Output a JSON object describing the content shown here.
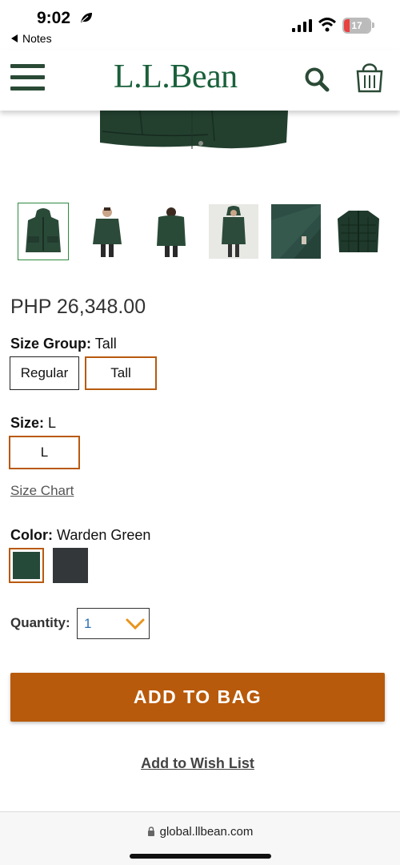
{
  "status_bar": {
    "time": "9:02",
    "back_app": "Notes",
    "battery": "17",
    "icons": [
      "focus-leaf-icon",
      "signal-icon",
      "wifi-icon",
      "battery-icon"
    ]
  },
  "header": {
    "logo_text": "L.L.Bean",
    "icons": [
      "menu-icon",
      "search-icon",
      "shopping-bag-icon"
    ],
    "brand_color": "#19603a"
  },
  "gallery": {
    "selected_index": 0,
    "thumbnails": [
      "jacket-front-hooded",
      "model-front",
      "model-back",
      "model-hood-up",
      "fabric-detail",
      "liner-jacket"
    ]
  },
  "product": {
    "price": "PHP 26,348.00",
    "size_group_label": "Size Group:",
    "size_group_value": "Tall",
    "size_group_options": [
      "Regular",
      "Tall"
    ],
    "size_label": "Size:",
    "size_value": "L",
    "size_options": [
      "L"
    ],
    "size_chart_link": "Size Chart",
    "color_label": "Color:",
    "color_value": "Warden Green",
    "color_swatches": [
      {
        "name": "Warden Green",
        "hex": "#264a39",
        "selected": true
      },
      {
        "name": "Charcoal",
        "hex": "#333739",
        "selected": false
      }
    ],
    "quantity_label": "Quantity:",
    "quantity_value": "1",
    "add_to_bag": "ADD TO BAG",
    "wish_list": "Add to Wish List",
    "accent_color": "#b85a0b"
  },
  "browser": {
    "url": "global.llbean.com"
  }
}
